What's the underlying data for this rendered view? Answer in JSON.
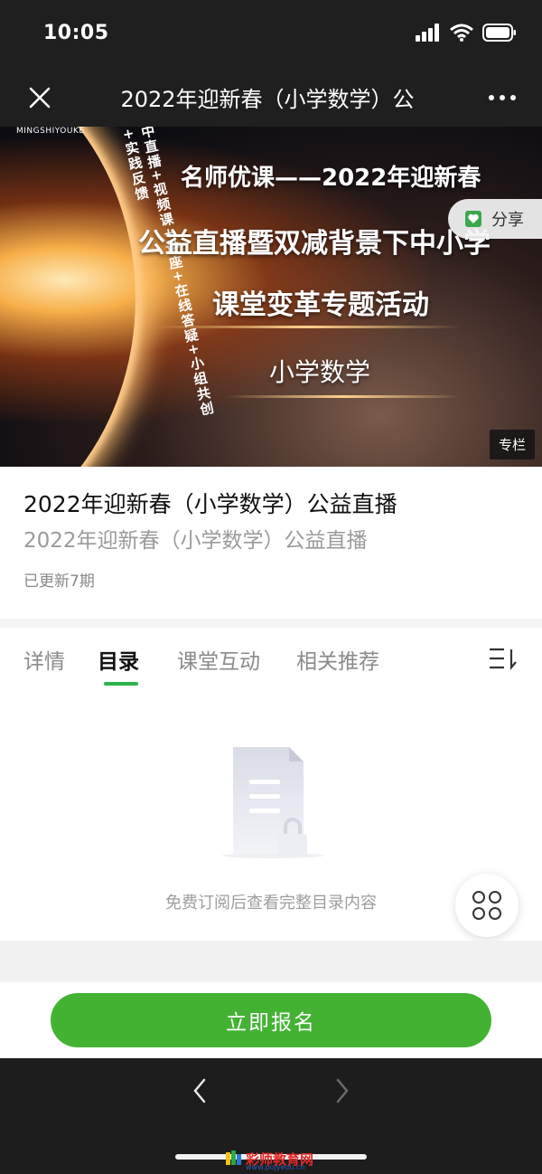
{
  "status": {
    "time": "10:05"
  },
  "nav": {
    "title": "2022年迎新春（小学数学）公",
    "close_icon": "close-icon",
    "more_icon": "more-icon"
  },
  "banner": {
    "brand": "MINGSHIYOUKE",
    "vertical_text": "中直播+视频课+讲座+在线答疑+小组共创+实践反馈",
    "line1": "名师优课——2022年迎新春",
    "line2": "公益直播暨双减背景下中小学",
    "line3": "课堂变革专题活动",
    "line4": "小学数学",
    "share_label": "分享",
    "column_tag": "专栏"
  },
  "course": {
    "title": "2022年迎新春（小学数学）公益直播",
    "subtitle": "2022年迎新春（小学数学）公益直播",
    "updates": "已更新7期"
  },
  "tabs": [
    {
      "label": "详情"
    },
    {
      "label": "目录"
    },
    {
      "label": "课堂互动"
    },
    {
      "label": "相关推荐"
    }
  ],
  "content": {
    "empty_text": "免费订阅后查看完整目录内容"
  },
  "footer": {
    "signup_label": "立即报名"
  },
  "watermark": {
    "text": "彩师教育网",
    "url": "www.pojyedu.cn"
  },
  "colors": {
    "accent": "#43b233",
    "indicator": "#2eb24a"
  }
}
